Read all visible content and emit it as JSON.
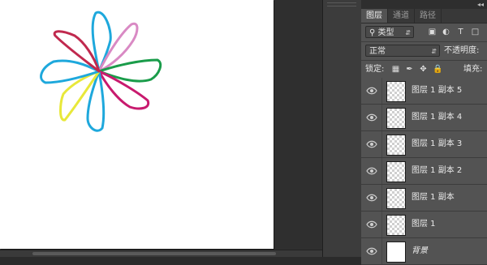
{
  "panel": {
    "tabs": [
      {
        "label": "图层"
      },
      {
        "label": "通道"
      },
      {
        "label": "路径"
      }
    ],
    "filter": {
      "kind_label": "类型"
    },
    "blend": {
      "mode": "正常",
      "opacity_label": "不透明度:"
    },
    "lock": {
      "label": "锁定:",
      "fill_label": "填充:"
    },
    "layers": [
      {
        "name": "图层 1 副本 5",
        "visible": true
      },
      {
        "name": "图层 1 副本 4",
        "visible": true
      },
      {
        "name": "图层 1 副本 3",
        "visible": true
      },
      {
        "name": "图层 1 副本 2",
        "visible": true
      },
      {
        "name": "图层 1 副本",
        "visible": true
      },
      {
        "name": "图层 1",
        "visible": true
      },
      {
        "name": "背景",
        "visible": true
      }
    ]
  },
  "canvas": {
    "petal_colors": [
      "#1ea8dc",
      "#d98ac4",
      "#1a9c4a",
      "#c81a6e",
      "#1ea8dc",
      "#e8e83a",
      "#1ea8dc",
      "#c0294e"
    ]
  }
}
